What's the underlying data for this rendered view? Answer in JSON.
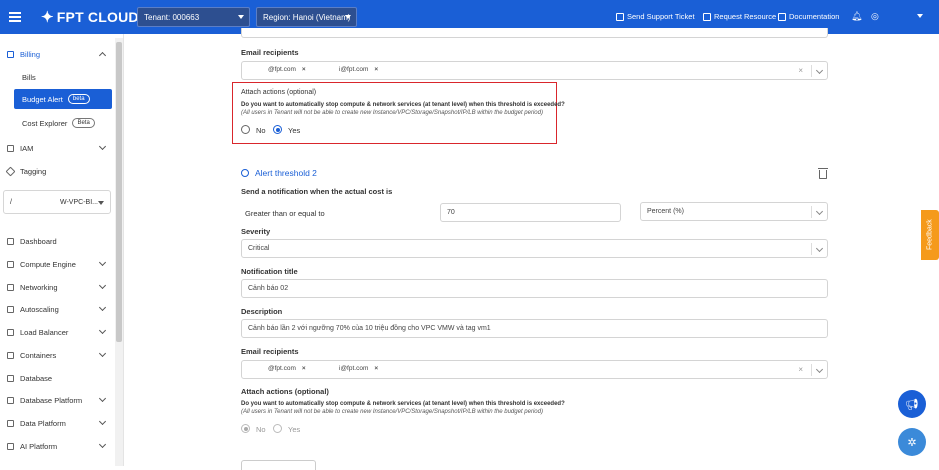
{
  "header": {
    "brand": "FPT CLOUD",
    "tenant": "Tenant: 000663",
    "region": "Region: Hanoi (Vietnam)",
    "send_ticket": "Send Support Ticket",
    "request_resource": "Request Resource",
    "documentation": "Documentation"
  },
  "sidebar": {
    "billing": "Billing",
    "bills": "Bills",
    "budget_alert": "Budget Alert",
    "budget_badge": "beta",
    "cost_explorer": "Cost Explorer",
    "cost_badge": "Beta",
    "iam": "IAM",
    "tagging": "Tagging",
    "vpc_select_prefix": "/",
    "vpc_select": "W-VPC-BI...",
    "items": [
      "Dashboard",
      "Compute Engine",
      "Networking",
      "Autoscaling",
      "Load Balancer",
      "Containers",
      "Database",
      "Database Platform",
      "Data Platform",
      "AI Platform"
    ]
  },
  "threshold1": {
    "email_label": "Email recipients",
    "email_chips": [
      "@fpt.com",
      "i@fpt.com"
    ],
    "attach_label": "Attach actions (optional)",
    "question": "Do you want to automatically stop compute & network services (at tenant level) when this threshold is exceeded?",
    "note": "(All users in Tenant will not be able to create new Instance/VPC/Storage/Snapshot/IP/LB within the budget period)",
    "no": "No",
    "yes": "Yes",
    "selected": "Yes"
  },
  "threshold2": {
    "title": "Alert threshold 2",
    "send_label": "Send a notification when the actual cost is",
    "condition": "Greater than or equal to",
    "value": "70",
    "unit": "Percent (%)",
    "severity_label": "Severity",
    "severity": "Critical",
    "notif_title_label": "Notification title",
    "notif_title": "Cảnh báo 02",
    "description_label": "Description",
    "description": "Cảnh báo lần 2 với ngưỡng 70% của 10 triệu đồng cho VPC VMW và tag vm1",
    "email_label": "Email recipients",
    "email_chips": [
      "@fpt.com",
      "i@fpt.com"
    ],
    "attach_label": "Attach actions (optional)",
    "question": "Do you want to automatically stop compute & network services (at tenant level) when this threshold is exceeded?",
    "note": "(All users in Tenant will not be able to create new Instance/VPC/Storage/Snapshot/IP/LB within the budget period)",
    "no": "No",
    "yes": "Yes",
    "selected": "No"
  },
  "feedback": "Feedback",
  "colors": {
    "primary": "#1a5fd6",
    "highlight": "#d9262c",
    "feedback": "#f59a1b"
  }
}
